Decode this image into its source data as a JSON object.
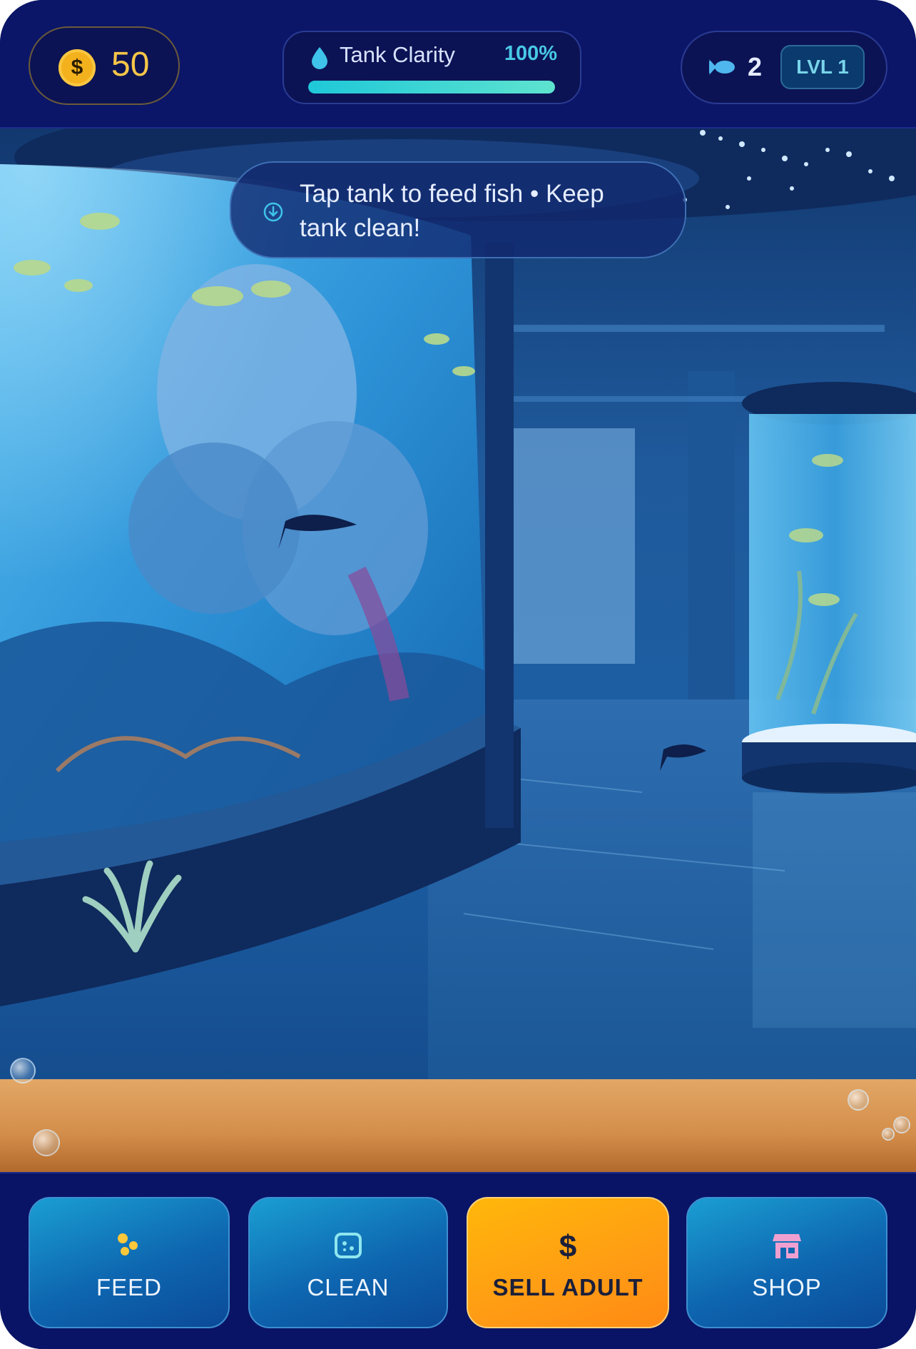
{
  "header": {
    "coins": {
      "icon": "coin-icon",
      "symbol": "$",
      "value": "50"
    },
    "tank_clarity": {
      "icon": "water-drop-icon",
      "label": "Tank Clarity",
      "value": "100%",
      "level": 1.0
    },
    "fish_count": {
      "icon": "fish-icon",
      "value": "2"
    },
    "level": {
      "label": "LVL 1"
    }
  },
  "hint": {
    "icon": "arrow-down-circle-icon",
    "text": "Tap tank to feed fish • Keep tank clean!"
  },
  "toolbar": {
    "buttons": [
      {
        "label": "FEED",
        "icon": "food-pellets-icon"
      },
      {
        "label": "CLEAN",
        "icon": "sponge-icon"
      },
      {
        "label": "SELL ADULT",
        "icon": "dollar-icon"
      },
      {
        "label": "SHOP",
        "icon": "store-icon"
      }
    ]
  },
  "colors": {
    "panel": "#0b1668",
    "accent_gold": "#f6c648",
    "accent_teal": "#48c9e6",
    "sell_orange": "#ff9c14",
    "button_blue": "#0e66b0",
    "sand": "#d38d4a"
  }
}
